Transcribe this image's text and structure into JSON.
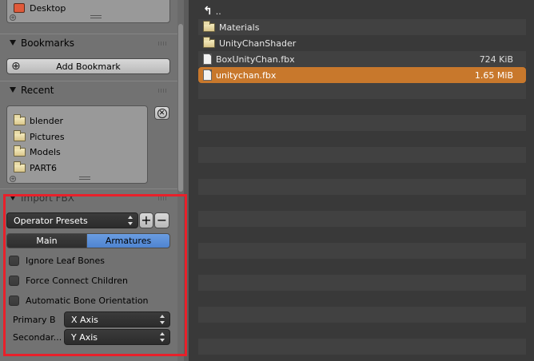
{
  "system": {
    "desktop_label": "Desktop"
  },
  "bookmarks": {
    "title": "Bookmarks",
    "add_label": "Add Bookmark"
  },
  "recent": {
    "title": "Recent",
    "items": [
      "blender",
      "Pictures",
      "Models",
      "PART6"
    ]
  },
  "import_panel": {
    "title": "Import FBX",
    "presets_label": "Operator Presets",
    "tabs": [
      {
        "label": "Main",
        "active": false
      },
      {
        "label": "Armatures",
        "active": true
      }
    ],
    "options": [
      {
        "label": "Ignore Leaf Bones",
        "checked": false
      },
      {
        "label": "Force Connect Children",
        "checked": false
      },
      {
        "label": "Automatic Bone Orientation",
        "checked": false
      }
    ],
    "primary_label": "Primary B",
    "primary_value": "X Axis",
    "secondary_label": "Secondar...",
    "secondary_value": "Y Axis"
  },
  "files": [
    {
      "name": "..",
      "type": "parent",
      "size": ""
    },
    {
      "name": "Materials",
      "type": "folder",
      "size": ""
    },
    {
      "name": "UnityChanShader",
      "type": "folder",
      "size": ""
    },
    {
      "name": "BoxUnityChan.fbx",
      "type": "file",
      "size": "724 KiB"
    },
    {
      "name": "unitychan.fbx",
      "type": "file",
      "size": "1.65 MiB",
      "selected": true
    }
  ],
  "colors": {
    "selection": "#c8782c",
    "active_tab": "#5a8ed8",
    "highlight": "#e8202a"
  }
}
